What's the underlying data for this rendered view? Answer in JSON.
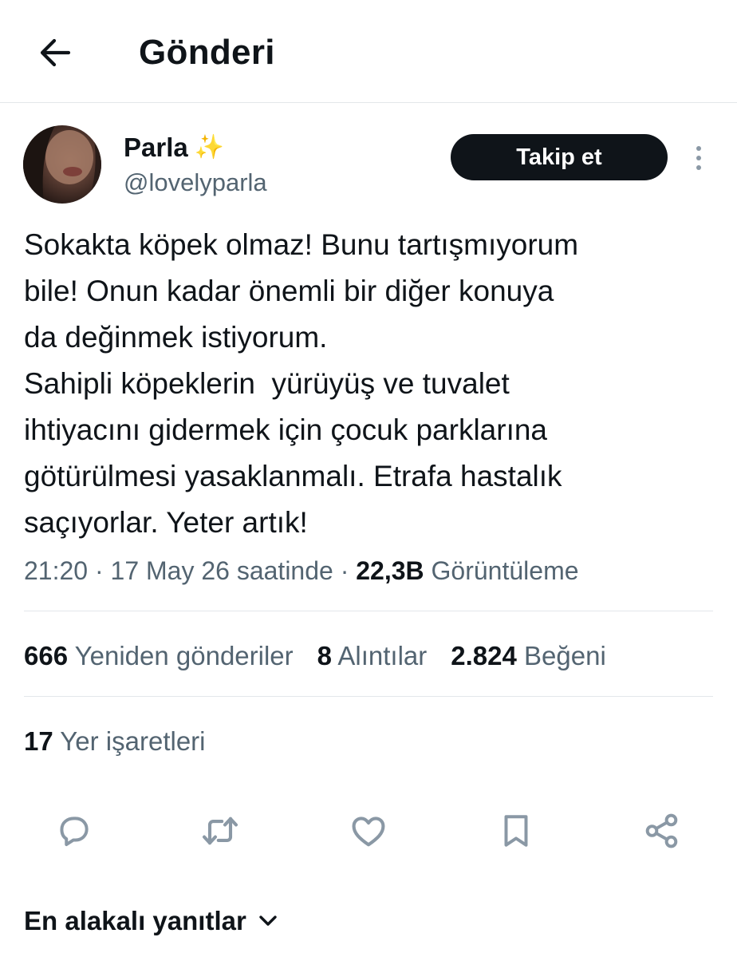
{
  "header": {
    "title": "Gönderi",
    "back_icon": "arrow-left-icon"
  },
  "author": {
    "name": "Parla",
    "emoji": "✨",
    "handle": "@lovelyparla",
    "follow_label": "Takip et"
  },
  "tweet": {
    "text": "Sokakta köpek olmaz! Bunu tartışmıyorum\nbile! Onun kadar önemli bir diğer konuya\nda değinmek istiyorum.\nSahipli köpeklerin  yürüyüş ve tuvalet\nihtiyacını gidermek için çocuk parklarına\ngötürülmesi yasaklanmalı. Etrafa hastalık\nsaçıyorlar. Yeter artık!",
    "time": "21:20",
    "date": "17 May 26 saatinde",
    "views_count": "22,3B",
    "views_label": "Görüntüleme"
  },
  "stats": {
    "reposts_count": "666",
    "reposts_label": "Yeniden gönderiler",
    "quotes_count": "8",
    "quotes_label": "Alıntılar",
    "likes_count": "2.824",
    "likes_label": "Beğeni",
    "bookmarks_count": "17",
    "bookmarks_label": "Yer işaretleri"
  },
  "actions": [
    "reply-icon",
    "repost-icon",
    "like-icon",
    "bookmark-icon",
    "share-icon"
  ],
  "replies": {
    "sort_label": "En alakalı yanıtlar"
  },
  "colors": {
    "text": "#0f1419",
    "secondary": "#536471",
    "icon": "#8a98a5",
    "divider": "#e3e7ea",
    "button_bg": "#0f1419"
  }
}
